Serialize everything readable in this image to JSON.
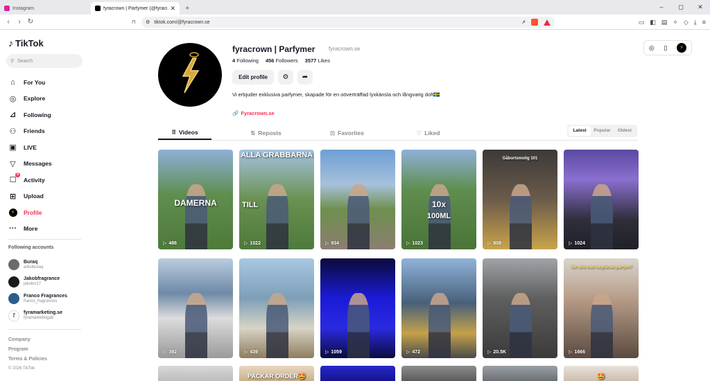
{
  "browser": {
    "tabs": [
      {
        "title": "Instagram",
        "color": "#d6249f"
      },
      {
        "title": "fyracrown | Parfymer (@fyracrow",
        "color": "#000000"
      }
    ],
    "new_tab": "+",
    "url": "tiktok.com/@fyracrown.se",
    "window_controls": [
      "–",
      "◻",
      "✕"
    ]
  },
  "sidebar": {
    "logo": "TikTok",
    "search_placeholder": "Search",
    "menu": [
      {
        "label": "For You",
        "icon": "⌂"
      },
      {
        "label": "Explore",
        "icon": "◎"
      },
      {
        "label": "Following",
        "icon": "⟶"
      },
      {
        "label": "Friends",
        "icon": "👥"
      },
      {
        "label": "LIVE",
        "icon": "▣"
      },
      {
        "label": "Messages",
        "icon": "▽"
      },
      {
        "label": "Activity",
        "icon": "☐",
        "badge": "9"
      },
      {
        "label": "Upload",
        "icon": "⊞"
      },
      {
        "label": "Profile",
        "icon": "⚡",
        "active": true
      },
      {
        "label": "More",
        "icon": "···"
      }
    ],
    "following_title": "Following accounts",
    "accounts": [
      {
        "name": "Buraq",
        "handle": "artistburaq",
        "color": "#6b6b6b"
      },
      {
        "name": "Jakobfragrance",
        "handle": "jakobrr17",
        "color": "#1a1a1a"
      },
      {
        "name": "Franco Fragrances",
        "handle": "franco_fragrances",
        "color": "#2a5d8f"
      },
      {
        "name": "fyramarketing.se",
        "handle": "fyramarketingab",
        "color": "#ffffff"
      }
    ],
    "footer": [
      "Company",
      "Program",
      "Terms & Policies"
    ],
    "copyright": "© 2026 TikTok"
  },
  "profile": {
    "name": "fyracrown | Parfymer",
    "nickname": "fyracrown.se",
    "following_count": "4",
    "following_label": "Following",
    "followers_count": "456",
    "followers_label": "Followers",
    "likes_count": "3577",
    "likes_label": "Likes",
    "edit_label": "Edit profile",
    "bio": "Vi erbjuder exklusiva parfymer, skapade för en oöverträffad lyxkänsla och långvarig doft🇸🇪",
    "link": "Fyracrown.se"
  },
  "tabs": [
    {
      "label": "Videos",
      "icon": "⠿"
    },
    {
      "label": "Reposts",
      "icon": "⇅"
    },
    {
      "label": "Favorites",
      "icon": "⊡"
    },
    {
      "label": "Liked",
      "icon": "♡"
    }
  ],
  "sort": [
    "Latest",
    "Popular",
    "Oldest"
  ],
  "videos": [
    {
      "views": "486",
      "overlay": "DAMERNA",
      "bg": "linear-gradient(180deg,#8fb0d8 0%,#5f8e4f 45%,#4e7a3a 100%)"
    },
    {
      "views": "1022",
      "overlay": "ALLA GRABBARNA",
      "overlay2": "TILL",
      "bg": "linear-gradient(180deg,#a4c2e0 0%,#6a9151 50%,#4d7a3b 100%)"
    },
    {
      "views": "934",
      "overlay": "",
      "bg": "linear-gradient(180deg,#6d9fd6 0%,#a7c1db 35%,#6e8f4c 60%,#8b7e72 100%)"
    },
    {
      "views": "1023",
      "overlay": "10x",
      "overlay2": "100ML",
      "bg": "linear-gradient(180deg,#8fb0d8 0%,#5f8e4f 40%,#4a7437 100%)"
    },
    {
      "views": "808",
      "overlay": "Gåbortsmolig 101",
      "bg": "linear-gradient(180deg,#3c3a38 0%,#6b5b4b 50%,#c9a44a 100%)"
    },
    {
      "views": "1024",
      "overlay": "",
      "bg": "linear-gradient(180deg,#5a4aa0 0%,#8a6fcf 30%,#2f2f3b 70%,#202028 100%)"
    },
    {
      "views": "392",
      "overlay": "",
      "bg": "linear-gradient(180deg,#b9cde0 0%,#6f8aa6 35%,#dcdcdc 60%,#9a9a9a 100%)"
    },
    {
      "views": "439",
      "overlay": "",
      "bg": "linear-gradient(180deg,#a9c7e3 0%,#7d9fb8 40%,#d8d4c6 70%,#8e7d5d 100%)"
    },
    {
      "views": "1059",
      "overlay": "",
      "bg": "linear-gradient(180deg,#0a0a3a 0%,#1b1bd8 40%,#2a2ae0 70%,#0b0b40 100%)"
    },
    {
      "views": "472",
      "overlay": "",
      "bg": "linear-gradient(180deg,#8fb3d9 0%,#47607a 45%,#c4a14a 75%,#4a4a4a 100%)"
    },
    {
      "views": "20.5K",
      "overlay": "",
      "bg": "linear-gradient(180deg,#9fa4a8 0%,#5e5f5e 40%,#3a3a3a 100%)"
    },
    {
      "views": "1666",
      "overlay": "Var ska man begränsa parfym?",
      "bg": "linear-gradient(180deg,#d9d4cd 0%,#b79d88 40%,#5b4a40 100%)"
    }
  ],
  "videos_row3": [
    {
      "overlay": "",
      "bg": "linear-gradient(180deg,#d8d8d8,#bdbdbd)"
    },
    {
      "overlay": "PACKAR ORDER🤩",
      "bg": "linear-gradient(180deg,#e8d7bf,#c9b08c)"
    },
    {
      "overlay": "",
      "bg": "linear-gradient(180deg,#2727c9,#141490)"
    },
    {
      "overlay": "",
      "bg": "linear-gradient(180deg,#8c8c8c,#5c5c5c)"
    },
    {
      "overlay": "",
      "bg": "linear-gradient(180deg,#9aa0a5,#6c7075)"
    },
    {
      "overlay": "🤩",
      "bg": "linear-gradient(180deg,#e8e2da,#cbbfae)"
    }
  ]
}
